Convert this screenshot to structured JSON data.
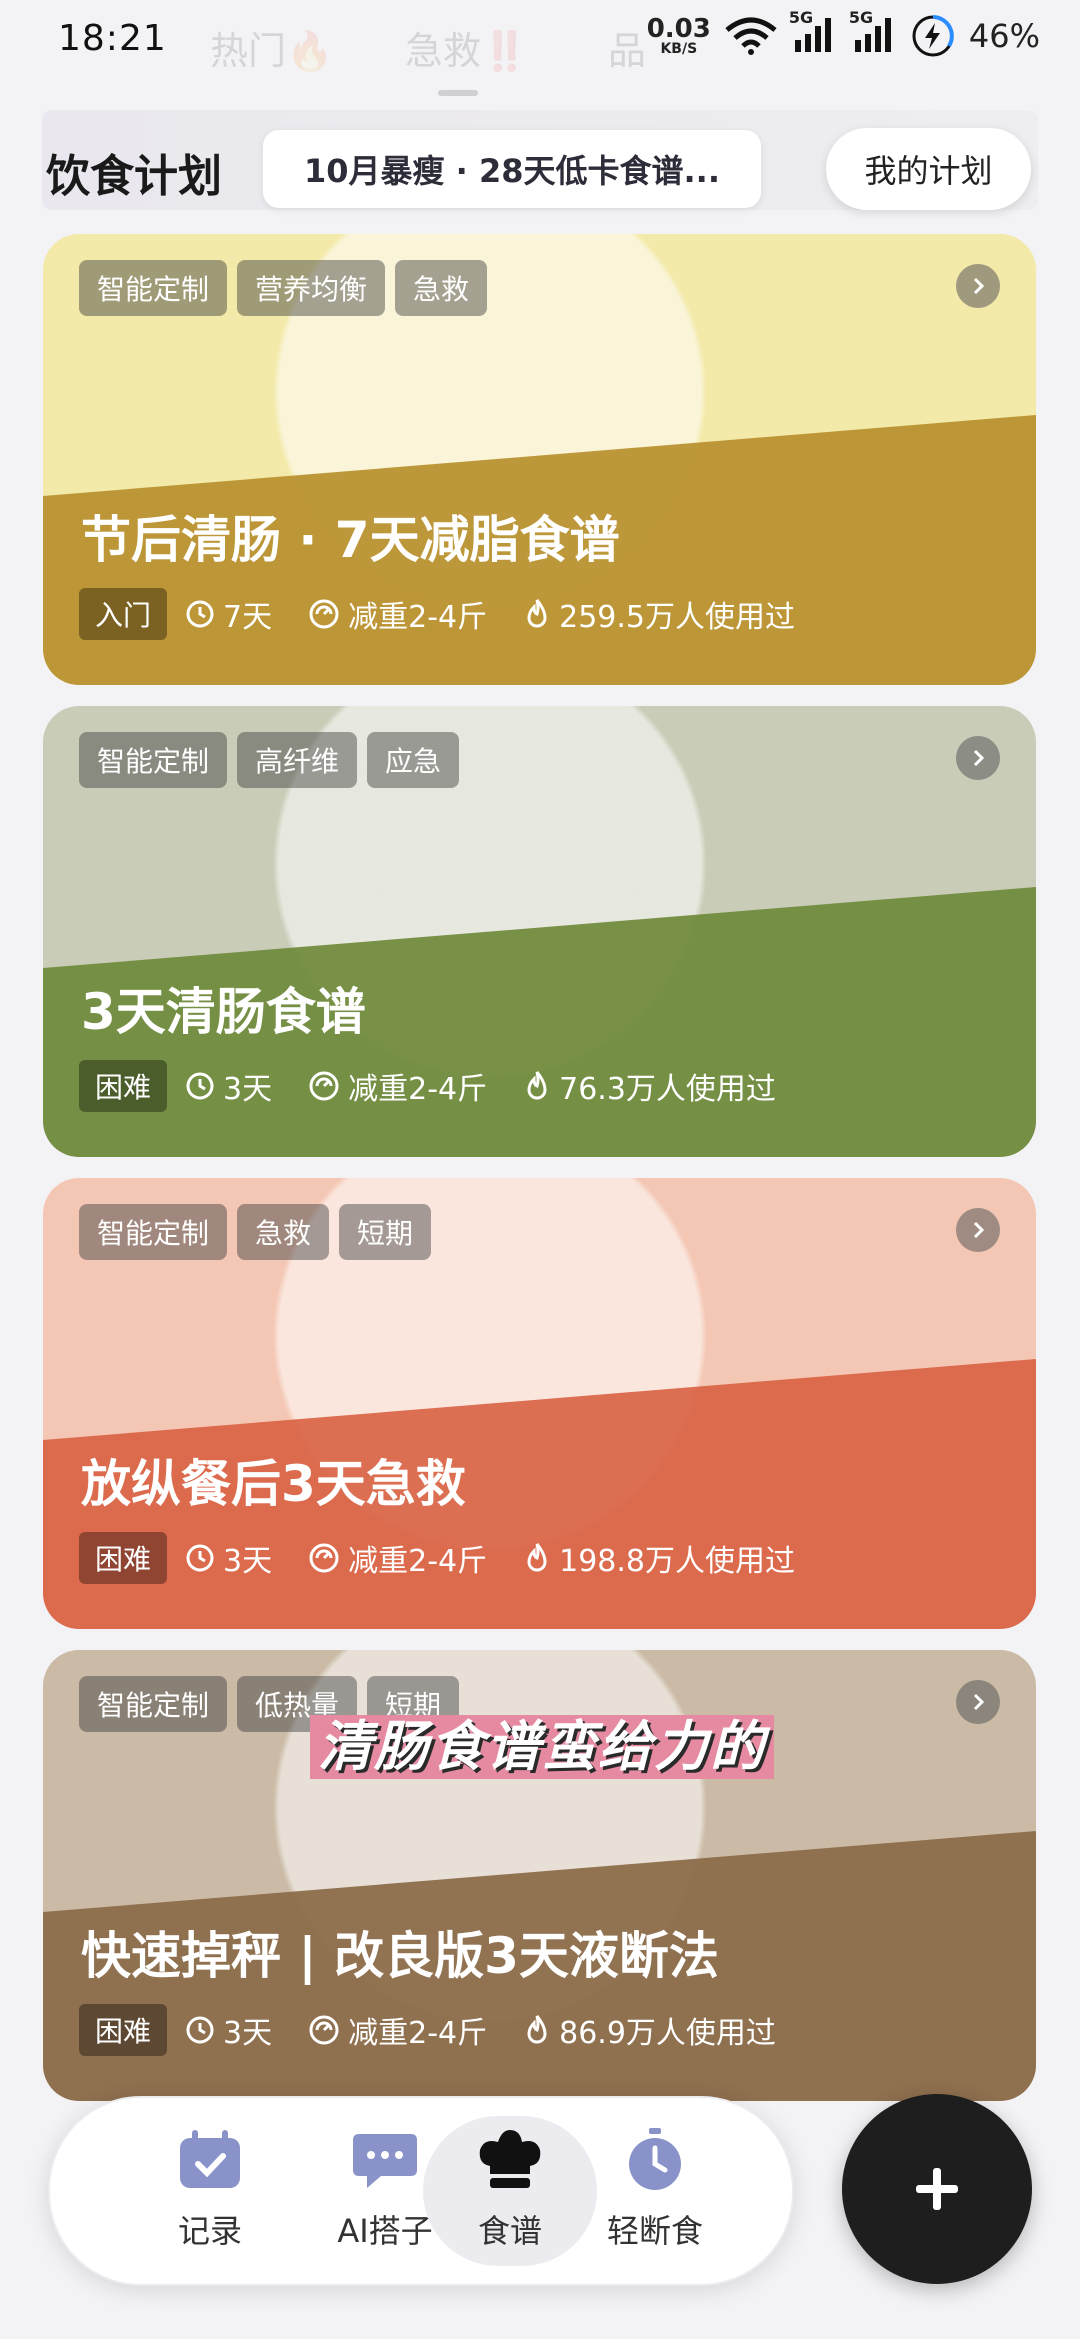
{
  "status_bar": {
    "time": "18:21",
    "speed_value": "0.03",
    "speed_unit": "KB/S",
    "network_1": "5G",
    "network_2": "5G",
    "battery": "46%",
    "ghost_tabs": [
      "热门🔥",
      "急救‼️",
      "品"
    ]
  },
  "header": {
    "title": "饮食计划",
    "banner_text": "10月暴瘦 · 28天低卡食谱...",
    "my_plan_button": "我的计划"
  },
  "cards": [
    {
      "tags": [
        "智能定制",
        "营养均衡",
        "急救"
      ],
      "title": "节后清肠 · 7天减脂食谱",
      "level": "入门",
      "duration": "7天",
      "loss": "减重2-4斤",
      "users": "259.5万人使用过",
      "band_color": "#b8902e",
      "top_color": "#f3e9a8"
    },
    {
      "tags": [
        "智能定制",
        "高纤维",
        "应急"
      ],
      "title": "3天清肠食谱",
      "level": "困难",
      "duration": "3天",
      "loss": "减重2-4斤",
      "users": "76.3万人使用过",
      "band_color": "#6f8a3b",
      "top_color": "#c9cdb8"
    },
    {
      "tags": [
        "智能定制",
        "急救",
        "短期"
      ],
      "title": "放纵餐后3天急救",
      "level": "困难",
      "duration": "3天",
      "loss": "减重2-4斤",
      "users": "198.8万人使用过",
      "band_color": "#d96446",
      "top_color": "#f4c7b4"
    },
    {
      "tags": [
        "智能定制",
        "低热量",
        "短期"
      ],
      "title": "快速掉秤 | 改良版3天液断法",
      "level": "困难",
      "duration": "3天",
      "loss": "减重2-4斤",
      "users": "86.9万人使用过",
      "band_color": "#8a6a48",
      "top_color": "#cbbba6"
    }
  ],
  "overlay_caption": "清肠食谱蛮给力的",
  "nav": {
    "items": [
      {
        "label": "记录",
        "icon": "calendar-check-icon"
      },
      {
        "label": "AI搭子",
        "icon": "chat-bubble-icon"
      },
      {
        "label": "食谱",
        "icon": "chef-hat-icon"
      },
      {
        "label": "轻断食",
        "icon": "stopwatch-icon"
      }
    ],
    "active_index": 2,
    "fab_icon": "plus-icon"
  }
}
